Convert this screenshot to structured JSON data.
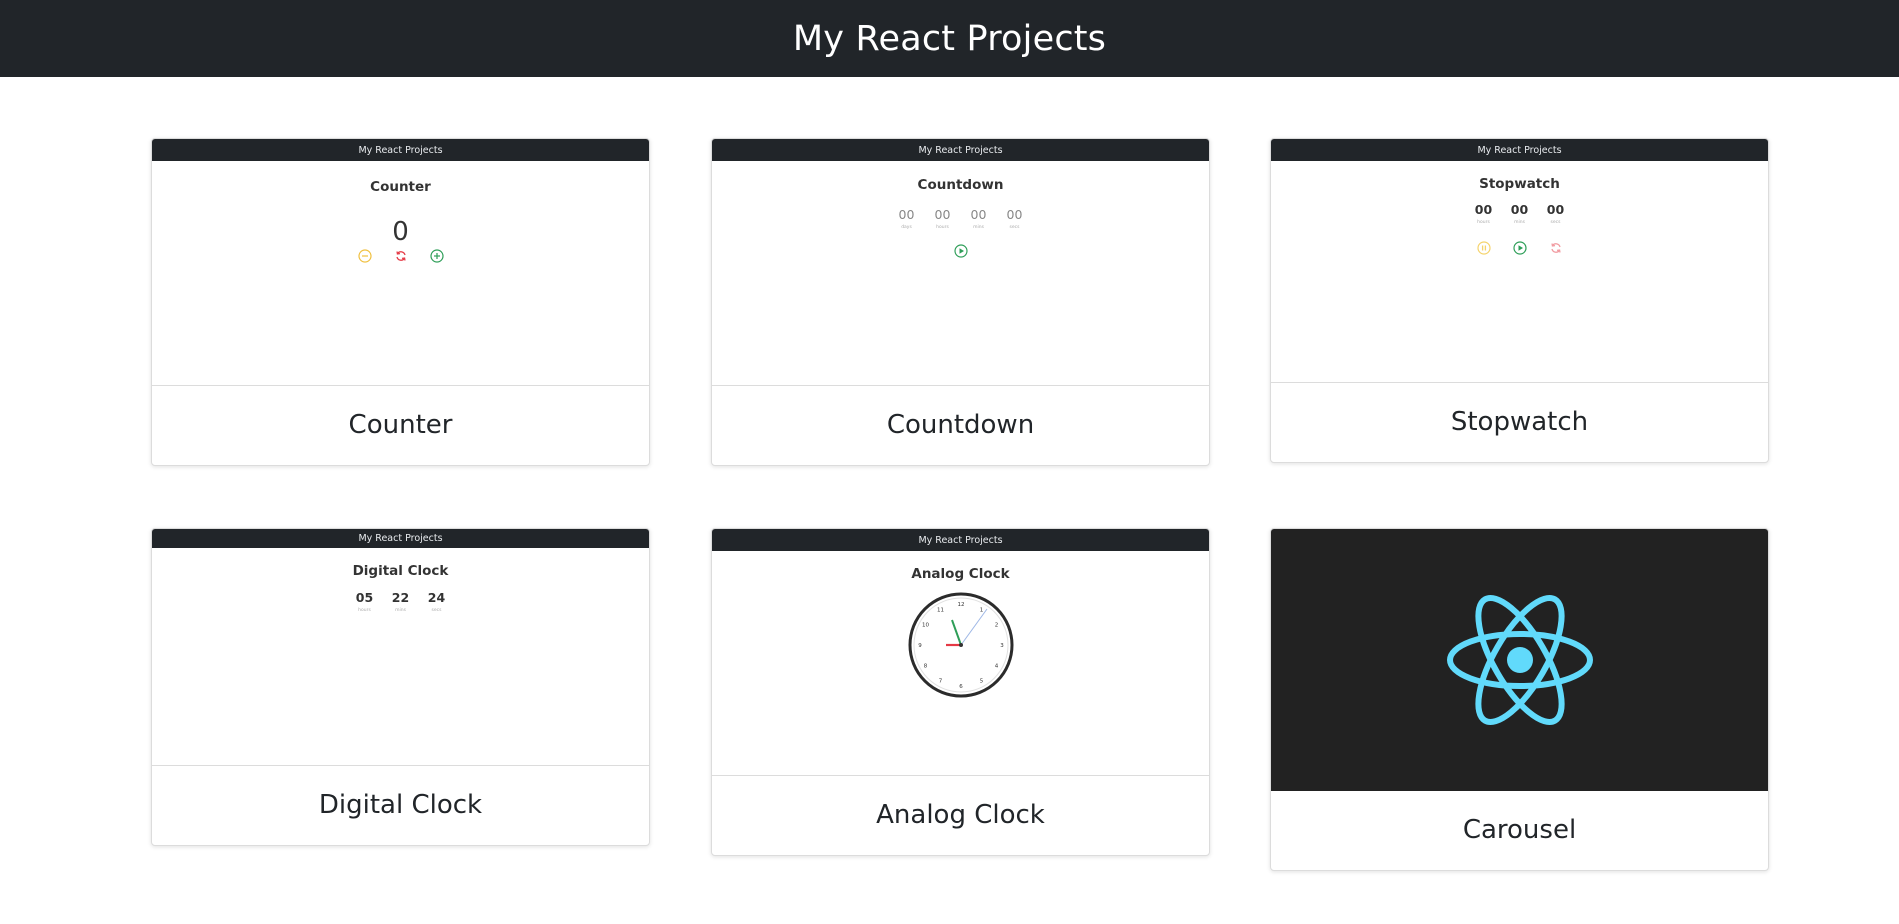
{
  "header": {
    "title": "My React Projects"
  },
  "projects": [
    {
      "name": "Counter",
      "preview": {
        "nav_title": "My React Projects",
        "title": "Counter",
        "value": "0",
        "buttons": [
          "minus-icon",
          "reset-icon",
          "plus-icon"
        ]
      }
    },
    {
      "name": "Countdown",
      "preview": {
        "nav_title": "My React Projects",
        "title": "Countdown",
        "units": [
          {
            "value": "00",
            "label": "days"
          },
          {
            "value": "00",
            "label": "hours"
          },
          {
            "value": "00",
            "label": "mins"
          },
          {
            "value": "00",
            "label": "secs"
          }
        ],
        "buttons": [
          "play-icon"
        ]
      }
    },
    {
      "name": "Stopwatch",
      "preview": {
        "nav_title": "My React Projects",
        "title": "Stopwatch",
        "units": [
          {
            "value": "00",
            "label": "hours"
          },
          {
            "value": "00",
            "label": "mins"
          },
          {
            "value": "00",
            "label": "secs"
          }
        ],
        "buttons": [
          "pause-icon",
          "play-icon",
          "reset-icon"
        ]
      }
    },
    {
      "name": "Digital Clock",
      "preview": {
        "nav_title": "My React Projects",
        "title": "Digital Clock",
        "units": [
          {
            "value": "05",
            "label": "hours"
          },
          {
            "value": "22",
            "label": "mins"
          },
          {
            "value": "24",
            "label": "secs"
          }
        ]
      }
    },
    {
      "name": "Analog Clock",
      "preview": {
        "nav_title": "My React Projects",
        "title": "Analog Clock",
        "clock_numbers": [
          "12",
          "1",
          "2",
          "3",
          "4",
          "5",
          "6",
          "7",
          "8",
          "9",
          "10",
          "11"
        ]
      }
    },
    {
      "name": "Carousel",
      "preview": {
        "image": "react-logo"
      }
    }
  ],
  "colors": {
    "navbar": "#212529",
    "react_cyan": "#61dafb",
    "minus": "#f0c040",
    "reset": "#e53945",
    "plus": "#2e9e58",
    "pause": "#f5d36c",
    "play": "#2e9e58",
    "reset_light": "#f19aa0"
  }
}
